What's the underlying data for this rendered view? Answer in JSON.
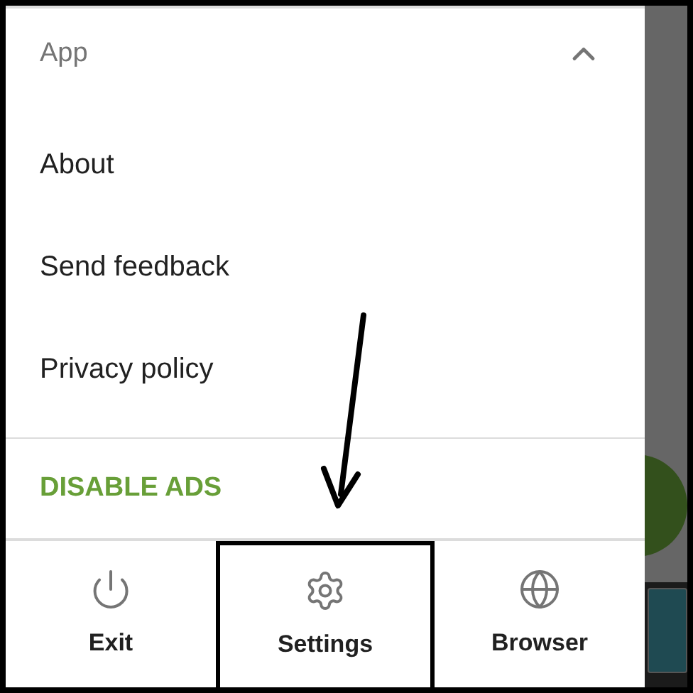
{
  "menu": {
    "section": {
      "title": "App",
      "expanded": true
    },
    "items": [
      {
        "label": "About"
      },
      {
        "label": "Send feedback"
      },
      {
        "label": "Privacy policy"
      }
    ],
    "action": {
      "label": "DISABLE ADS"
    }
  },
  "bottom_nav": [
    {
      "label": "Exit",
      "kind": "power",
      "highlighted": false
    },
    {
      "label": "Settings",
      "kind": "gear",
      "highlighted": true
    },
    {
      "label": "Browser",
      "kind": "globe",
      "highlighted": false
    }
  ],
  "annotation": {
    "kind": "arrow"
  }
}
